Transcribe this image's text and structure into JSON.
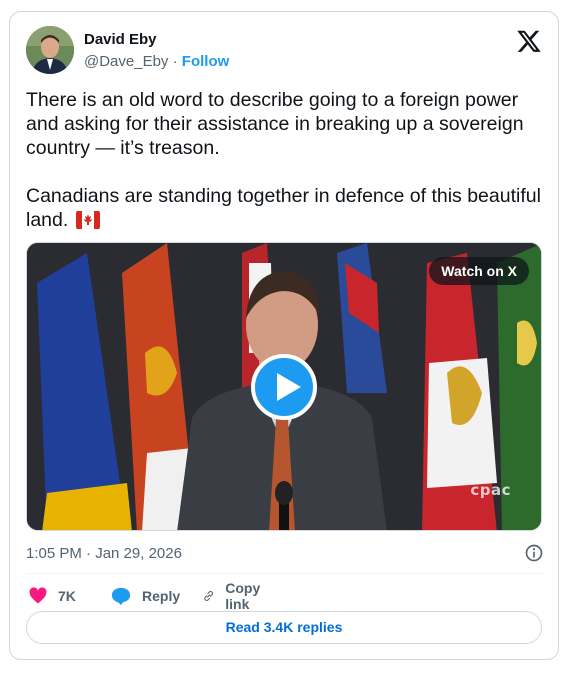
{
  "author": {
    "name": "David Eby",
    "handle": "@Dave_Eby",
    "separator": "·",
    "follow_label": "Follow",
    "avatar_icon": "profile-photo"
  },
  "platform_icon": "x-logo-icon",
  "tweet": {
    "text": "There is an old word to describe going to a foreign power and asking for their assistance in breaking up a sovereign country — it’s treason.\n\nCanadians are standing together in defence of this beautiful land.",
    "emoji": "canada-flag"
  },
  "media": {
    "watch_label": "Watch on X",
    "watermark": "cpac",
    "play_icon": "play-icon"
  },
  "timestamp": "1:05 PM · Jan 29, 2026",
  "info_icon": "info-icon",
  "actions": {
    "like_count": "7K",
    "reply_label": "Reply",
    "copy_label": "Copy link"
  },
  "read_replies_label": "Read 3.4K replies",
  "colors": {
    "accent": "#1d9bf0",
    "link": "#006fd6",
    "heart": "#f91880",
    "muted": "#536471",
    "border": "#cfd9de"
  }
}
